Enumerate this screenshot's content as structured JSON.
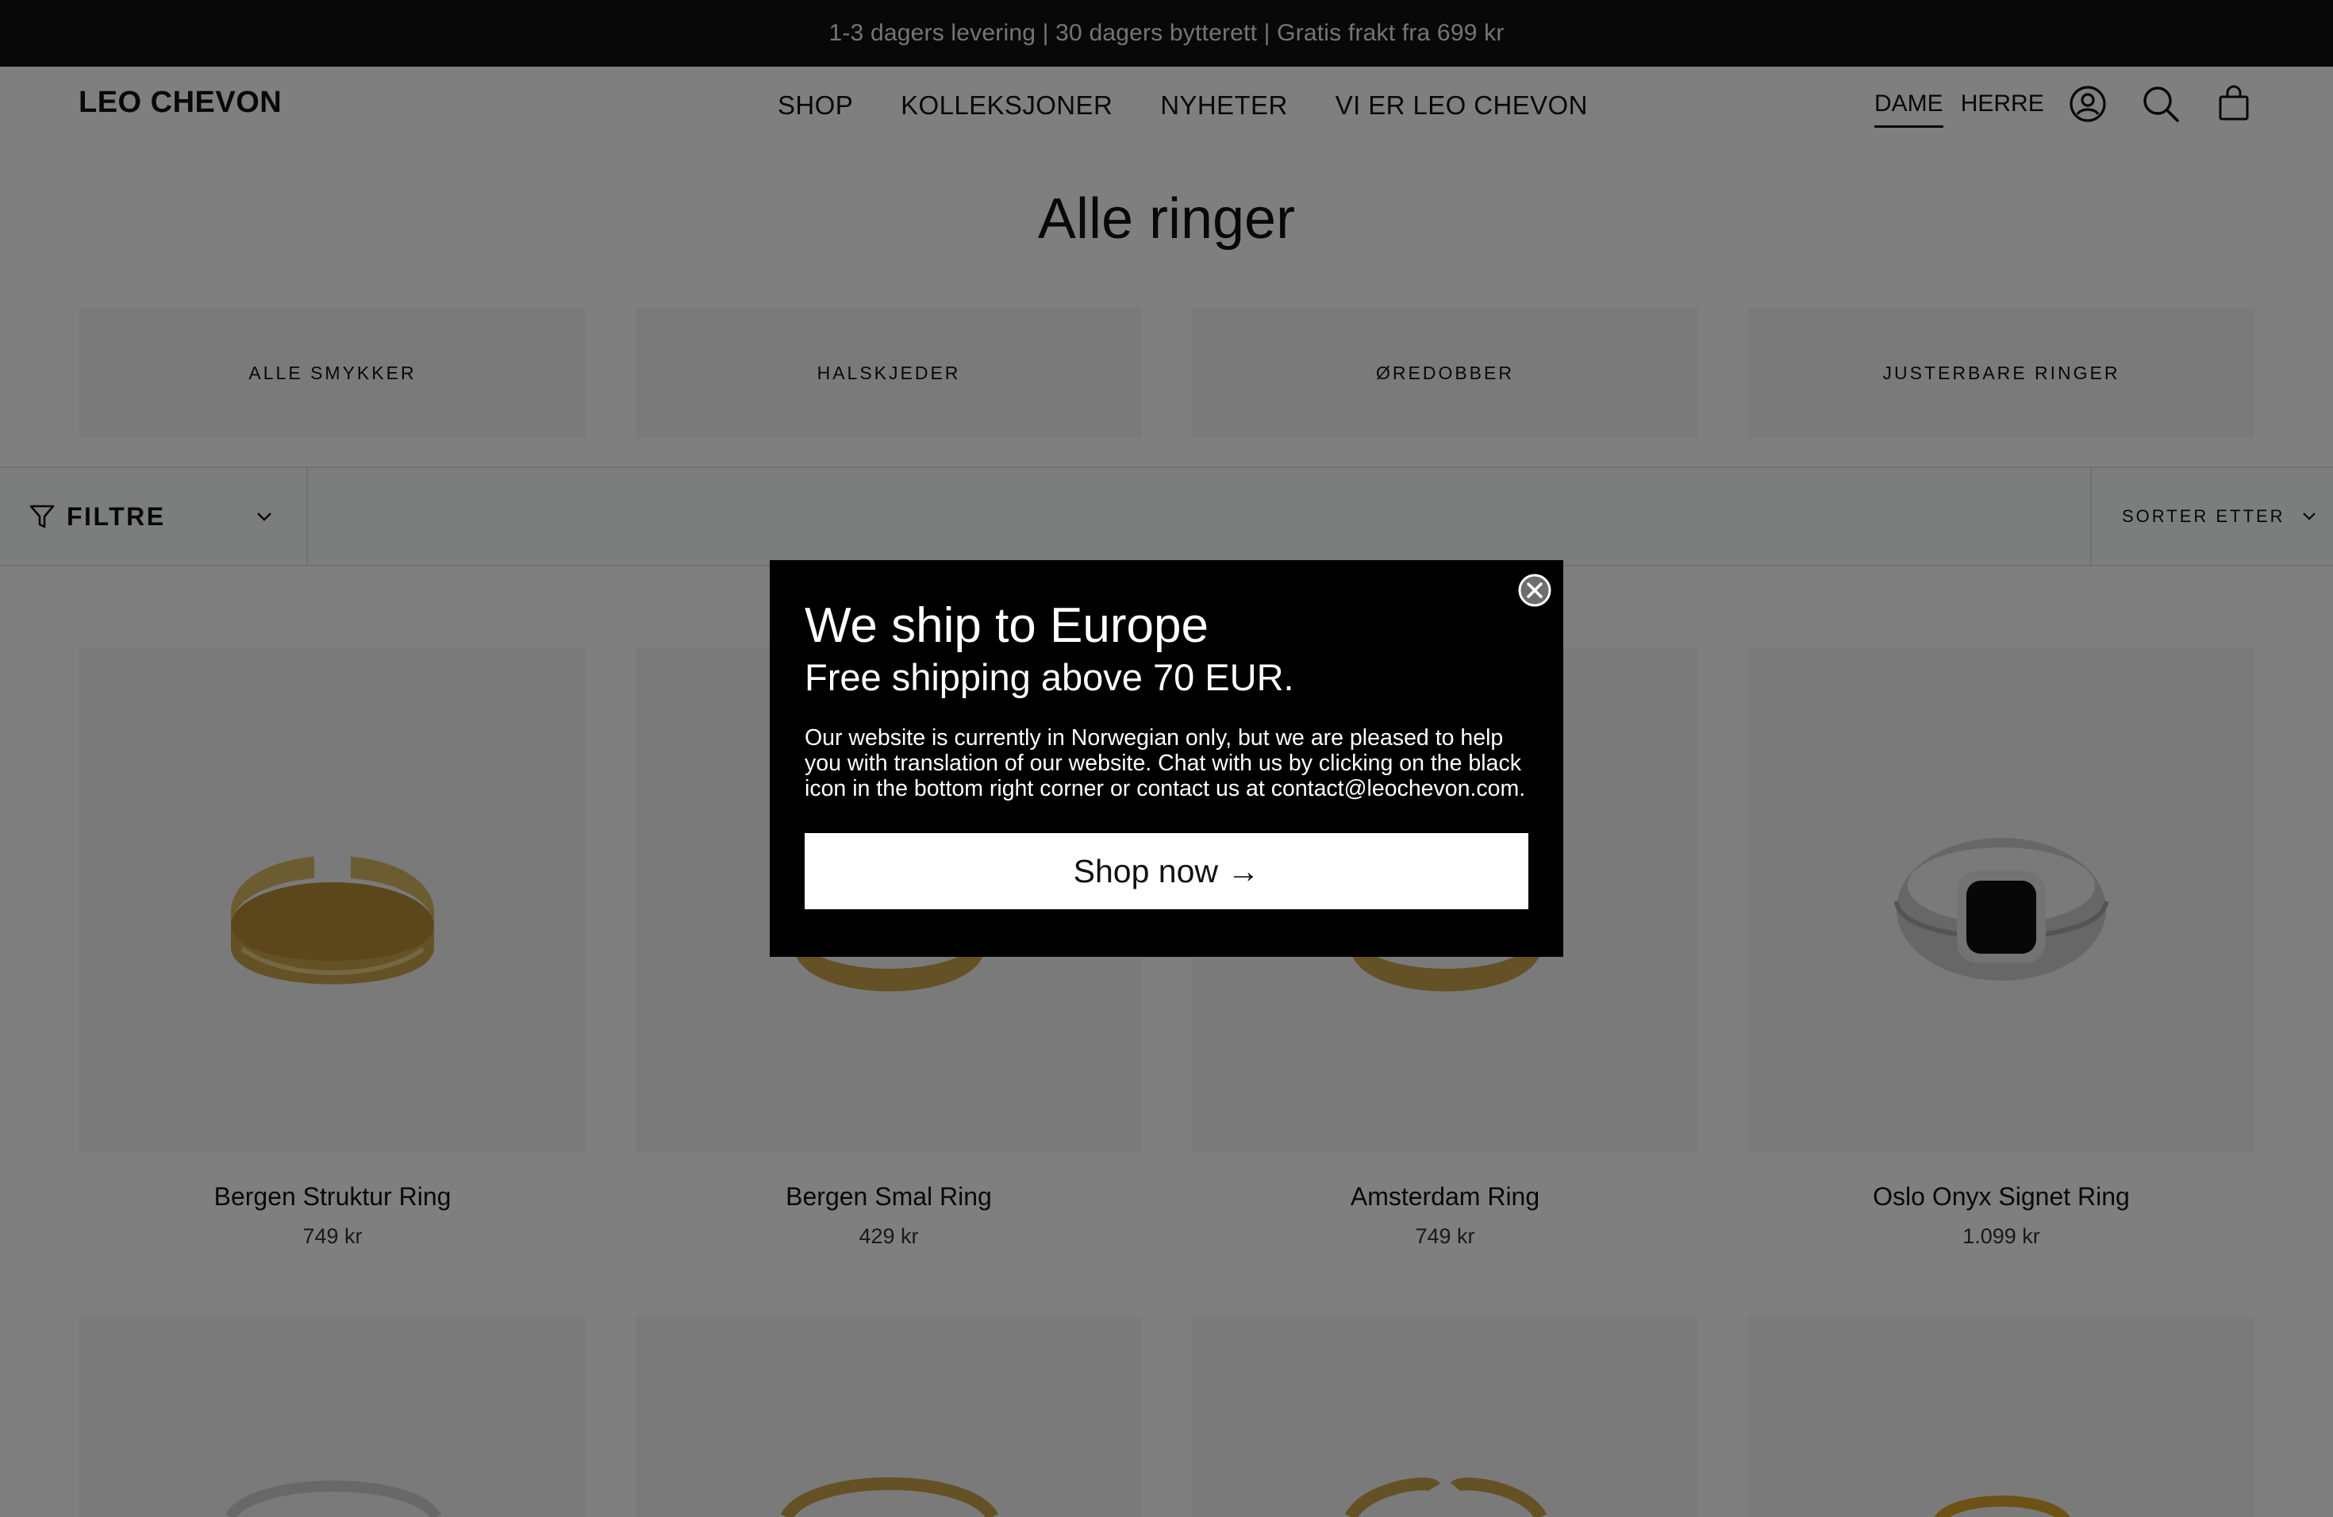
{
  "announcement": "1-3 dagers levering | 30 dagers bytterett | Gratis frakt fra 699 kr",
  "header": {
    "logo": "LEO CHEVON",
    "nav": [
      "SHOP",
      "KOLLEKSJONER",
      "NYHETER",
      "VI ER LEO CHEVON"
    ],
    "gender": {
      "active": "DAME",
      "other": "HERRE"
    },
    "icons": [
      "account-icon",
      "search-icon",
      "cart-icon"
    ]
  },
  "page_title": "Alle ringer",
  "categories": [
    "ALLE SMYKKER",
    "HALSKJEDER",
    "ØREDOBBER",
    "JUSTERBARE RINGER"
  ],
  "filter": {
    "label": "FILTRE",
    "sort_label": "SORTER ETTER"
  },
  "products": [
    {
      "name": "Bergen Struktur Ring",
      "price": "749 kr"
    },
    {
      "name": "Bergen Smal Ring",
      "price": "429 kr"
    },
    {
      "name": "Amsterdam Ring",
      "price": "749 kr"
    },
    {
      "name": "Oslo Onyx Signet Ring",
      "price": "1.099 kr"
    }
  ],
  "modal": {
    "title": "We ship to Europe",
    "subtitle": "Free shipping above 70 EUR.",
    "body": "Our website is currently in Norwegian only, but we are pleased to help you with translation of our website. Chat with us by clicking on the black icon in the bottom right corner or contact us at contact@leochevon.com.",
    "cta": "Shop now →"
  },
  "colors": {
    "announcement_bg": "#111111",
    "modal_bg": "#000000",
    "overlay": "rgba(0,0,0,0.5)",
    "tile_bg": "#f4f4f4",
    "gold": "#c9a24a",
    "silver": "#d8d8d8",
    "onyx": "#0e0e0e"
  }
}
